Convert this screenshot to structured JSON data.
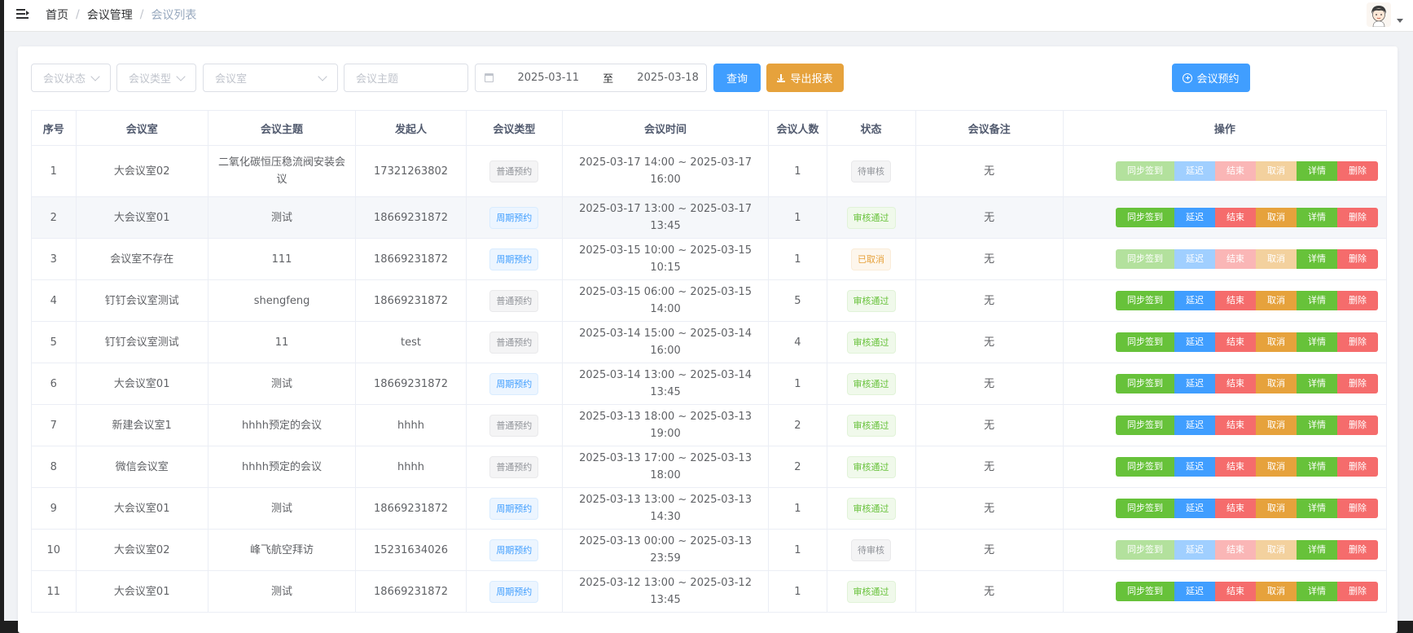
{
  "navbar": {
    "breadcrumb": [
      "首页",
      "会议管理",
      "会议列表"
    ],
    "separator": "/"
  },
  "filters": {
    "status_placeholder": "会议状态",
    "type_placeholder": "会议类型",
    "room_placeholder": "会议室",
    "topic_placeholder": "会议主题",
    "date_start": "2025-03-11",
    "date_to": "至",
    "date_end": "2025-03-18"
  },
  "buttons": {
    "query": "查询",
    "export": "导出报表",
    "book": "会议预约"
  },
  "table": {
    "columns": [
      "序号",
      "会议室",
      "会议主题",
      "发起人",
      "会议类型",
      "会议时间",
      "会议人数",
      "状态",
      "会议备注",
      "操作"
    ],
    "actions": [
      "同步签到",
      "延迟",
      "结束",
      "取消",
      "详情",
      "删除"
    ],
    "rows": [
      {
        "no": "1",
        "room": "大会议室02",
        "topic": "二氧化碳恒压稳流阀安装会议",
        "initiator": "17321263802",
        "type": "普通预约",
        "type_style": "info",
        "time": "2025-03-17 14:00 ~ 2025-03-17 16:00",
        "count": "1",
        "status": "待审核",
        "status_style": "info",
        "note": "无",
        "disabled": [
          true,
          true,
          true,
          true,
          false,
          false
        ]
      },
      {
        "no": "2",
        "room": "大会议室01",
        "topic": "测试",
        "initiator": "18669231872",
        "type": "周期预约",
        "type_style": "primary",
        "time": "2025-03-17 13:00 ~ 2025-03-17 13:45",
        "count": "1",
        "status": "审核通过",
        "status_style": "success",
        "note": "无",
        "disabled": [
          false,
          false,
          false,
          false,
          false,
          false
        ]
      },
      {
        "no": "3",
        "room": "会议室不存在",
        "topic": "111",
        "initiator": "18669231872",
        "type": "周期预约",
        "type_style": "primary",
        "time": "2025-03-15 10:00 ~ 2025-03-15 10:15",
        "count": "1",
        "status": "已取消",
        "status_style": "warning",
        "note": "无",
        "disabled": [
          true,
          true,
          true,
          true,
          false,
          false
        ]
      },
      {
        "no": "4",
        "room": "钉钉会议室测试",
        "topic": "shengfeng",
        "initiator": "18669231872",
        "type": "普通预约",
        "type_style": "info",
        "time": "2025-03-15 06:00 ~ 2025-03-15 14:00",
        "count": "5",
        "status": "审核通过",
        "status_style": "success",
        "note": "无",
        "disabled": [
          false,
          false,
          false,
          false,
          false,
          false
        ]
      },
      {
        "no": "5",
        "room": "钉钉会议室测试",
        "topic": "11",
        "initiator": "test",
        "type": "普通预约",
        "type_style": "info",
        "time": "2025-03-14 15:00 ~ 2025-03-14 16:00",
        "count": "4",
        "status": "审核通过",
        "status_style": "success",
        "note": "无",
        "disabled": [
          false,
          false,
          false,
          false,
          false,
          false
        ]
      },
      {
        "no": "6",
        "room": "大会议室01",
        "topic": "测试",
        "initiator": "18669231872",
        "type": "周期预约",
        "type_style": "primary",
        "time": "2025-03-14 13:00 ~ 2025-03-14 13:45",
        "count": "1",
        "status": "审核通过",
        "status_style": "success",
        "note": "无",
        "disabled": [
          false,
          false,
          false,
          false,
          false,
          false
        ]
      },
      {
        "no": "7",
        "room": "新建会议室1",
        "topic": "hhhh预定的会议",
        "initiator": "hhhh",
        "type": "普通预约",
        "type_style": "info",
        "time": "2025-03-13 18:00 ~ 2025-03-13 19:00",
        "count": "2",
        "status": "审核通过",
        "status_style": "success",
        "note": "无",
        "disabled": [
          false,
          false,
          false,
          false,
          false,
          false
        ]
      },
      {
        "no": "8",
        "room": "微信会议室",
        "topic": "hhhh预定的会议",
        "initiator": "hhhh",
        "type": "普通预约",
        "type_style": "info",
        "time": "2025-03-13 17:00 ~ 2025-03-13 18:00",
        "count": "2",
        "status": "审核通过",
        "status_style": "success",
        "note": "无",
        "disabled": [
          false,
          false,
          false,
          false,
          false,
          false
        ]
      },
      {
        "no": "9",
        "room": "大会议室01",
        "topic": "测试",
        "initiator": "18669231872",
        "type": "周期预约",
        "type_style": "primary",
        "time": "2025-03-13 13:00 ~ 2025-03-13 14:30",
        "count": "1",
        "status": "审核通过",
        "status_style": "success",
        "note": "无",
        "disabled": [
          false,
          false,
          false,
          false,
          false,
          false
        ]
      },
      {
        "no": "10",
        "room": "大会议室02",
        "topic": "峰飞航空拜访",
        "initiator": "15231634026",
        "type": "周期预约",
        "type_style": "primary",
        "time": "2025-03-13 00:00 ~ 2025-03-13 23:59",
        "count": "1",
        "status": "待审核",
        "status_style": "info",
        "note": "无",
        "disabled": [
          true,
          true,
          true,
          true,
          false,
          false
        ]
      },
      {
        "no": "11",
        "room": "大会议室01",
        "topic": "测试",
        "initiator": "18669231872",
        "type": "周期预约",
        "type_style": "primary",
        "time": "2025-03-12 13:00 ~ 2025-03-12 13:45",
        "count": "1",
        "status": "审核通过",
        "status_style": "success",
        "note": "无",
        "disabled": [
          false,
          false,
          false,
          false,
          false,
          false
        ]
      }
    ]
  }
}
